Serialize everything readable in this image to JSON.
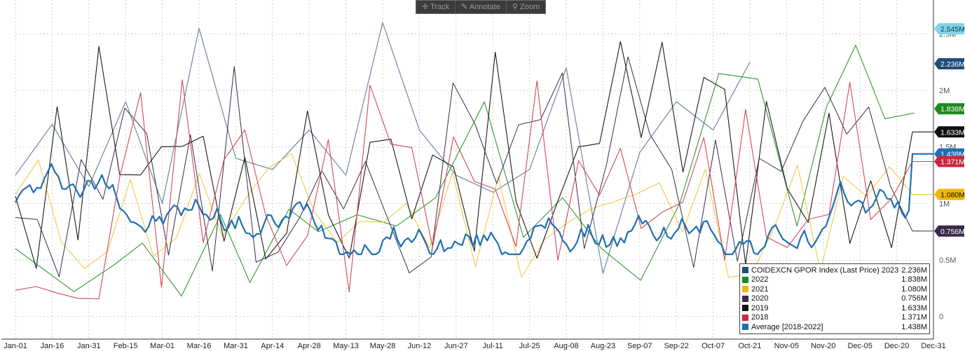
{
  "toolbar": {
    "track_label": "Track",
    "annotate_label": "Annotate",
    "zoom_label": "Zoom"
  },
  "chart_data": {
    "type": "line",
    "title": "",
    "xlabel": "",
    "ylabel": "",
    "x_ticks": [
      "Jan-01",
      "Jan-16",
      "Jan-31",
      "Feb-15",
      "Mar-01",
      "Mar-16",
      "Mar-31",
      "Apr-14",
      "Apr-28",
      "May-13",
      "May-28",
      "Jun-12",
      "Jun-27",
      "Jul-11",
      "Jul-25",
      "Aug-08",
      "Aug-23",
      "Sep-07",
      "Sep-22",
      "Oct-07",
      "Oct-21",
      "Nov-05",
      "Nov-20",
      "Dec-05",
      "Dec-20",
      "Dec-31"
    ],
    "y_ticks": [
      {
        "value": 0,
        "label": "0"
      },
      {
        "value": 500000,
        "label": "0.5M"
      },
      {
        "value": 1000000,
        "label": "1M"
      },
      {
        "value": 1500000,
        "label": "1.5M"
      },
      {
        "value": 2000000,
        "label": "2M"
      },
      {
        "value": 2500000,
        "label": "2.5M"
      }
    ],
    "ylim": [
      -200000,
      2800000
    ],
    "grid": true,
    "legend_position": "bottom-right",
    "value_badges": [
      {
        "label": "2.545M",
        "value": 2545000,
        "color": "#7fd4e8",
        "text_color": "#0b3a4a"
      },
      {
        "label": "2.236M",
        "value": 2236000,
        "color": "#1f4e79",
        "text_color": "#ffffff"
      },
      {
        "label": "1.838M",
        "value": 1838000,
        "color": "#1f8a1f",
        "text_color": "#ffffff"
      },
      {
        "label": "1.633M",
        "value": 1633000,
        "color": "#111111",
        "text_color": "#ffffff"
      },
      {
        "label": "1.438M",
        "value": 1438000,
        "color": "#1f6fb4",
        "text_color": "#ffffff"
      },
      {
        "label": "1.371M",
        "value": 1371000,
        "color": "#c8283c",
        "text_color": "#ffffff"
      },
      {
        "label": "1.080M",
        "value": 1080000,
        "color": "#f2b705",
        "text_color": "#111111"
      },
      {
        "label": "0.756M",
        "value": 756000,
        "color": "#3a2a4a",
        "text_color": "#ffffff"
      }
    ],
    "legend": [
      {
        "label": "COIDEXCN GPOR Index (Last Price) 2023",
        "value": "2.236M",
        "color": "#1f4e79"
      },
      {
        "label": "2022",
        "value": "1.838M",
        "color": "#1f8a1f"
      },
      {
        "label": "2021",
        "value": "1.080M",
        "color": "#f2b705"
      },
      {
        "label": "2020",
        "value": "0.756M",
        "color": "#3a2a4a"
      },
      {
        "label": "2019",
        "value": "1.633M",
        "color": "#111111"
      },
      {
        "label": "2018",
        "value": "1.371M",
        "color": "#c8283c"
      },
      {
        "label": "Average  [2018-2022]",
        "value": "1.438M",
        "color": "#1f6fb4"
      }
    ],
    "series": [
      {
        "key": "y2023",
        "color": "#7a8fa6",
        "width": 1.3,
        "x": [
          0,
          1,
          2,
          3,
          4,
          5,
          6,
          7,
          8,
          9,
          10,
          11,
          12,
          13,
          14,
          15,
          16,
          17,
          18,
          19,
          20
        ],
        "values": [
          1250000,
          1700000,
          1150000,
          1900000,
          1000000,
          2550000,
          1400000,
          1300000,
          1650000,
          1250000,
          2600000,
          1650000,
          1250000,
          1100000,
          1300000,
          2200000,
          380000,
          1450000,
          1900000,
          1650000,
          2250000
        ]
      },
      {
        "key": "y2022",
        "color": "#2f9a2f",
        "width": 1.1,
        "x": [
          0,
          1,
          2,
          3,
          4,
          5,
          6,
          7,
          8,
          9,
          10,
          11,
          12,
          13,
          14,
          15,
          16,
          17,
          18,
          19,
          20,
          21,
          22,
          23,
          24
        ],
        "values": [
          600000,
          220000,
          450000,
          650000,
          180000,
          900000,
          300000,
          950000,
          750000,
          900000,
          800000,
          1050000,
          1900000,
          700000,
          1050000,
          600000,
          320000,
          1000000,
          2150000,
          2100000,
          800000,
          1850000,
          2400000,
          1750000,
          1800000
        ],
        "x_pts": [
          0,
          1.2,
          2,
          2.6,
          3.4,
          4.2,
          4.8,
          5.6,
          6.2,
          7,
          7.8,
          8.6,
          9.6,
          10.4,
          11.2,
          12,
          12.8,
          13.6,
          14.4,
          15.2,
          16,
          16.6,
          17.2,
          17.8,
          18.4
        ]
      },
      {
        "key": "y2021",
        "color": "#f2c33a",
        "width": 1.0,
        "values": []
      },
      {
        "key": "y2020",
        "color": "#3a2a4a",
        "width": 1.0,
        "values": []
      },
      {
        "key": "y2019",
        "color": "#1a1a1a",
        "width": 1.1,
        "values": []
      },
      {
        "key": "y2018",
        "color": "#d2485c",
        "width": 1.1,
        "values": []
      },
      {
        "key": "average",
        "color": "#1f6fb4",
        "width": 2.2,
        "values": []
      }
    ]
  }
}
